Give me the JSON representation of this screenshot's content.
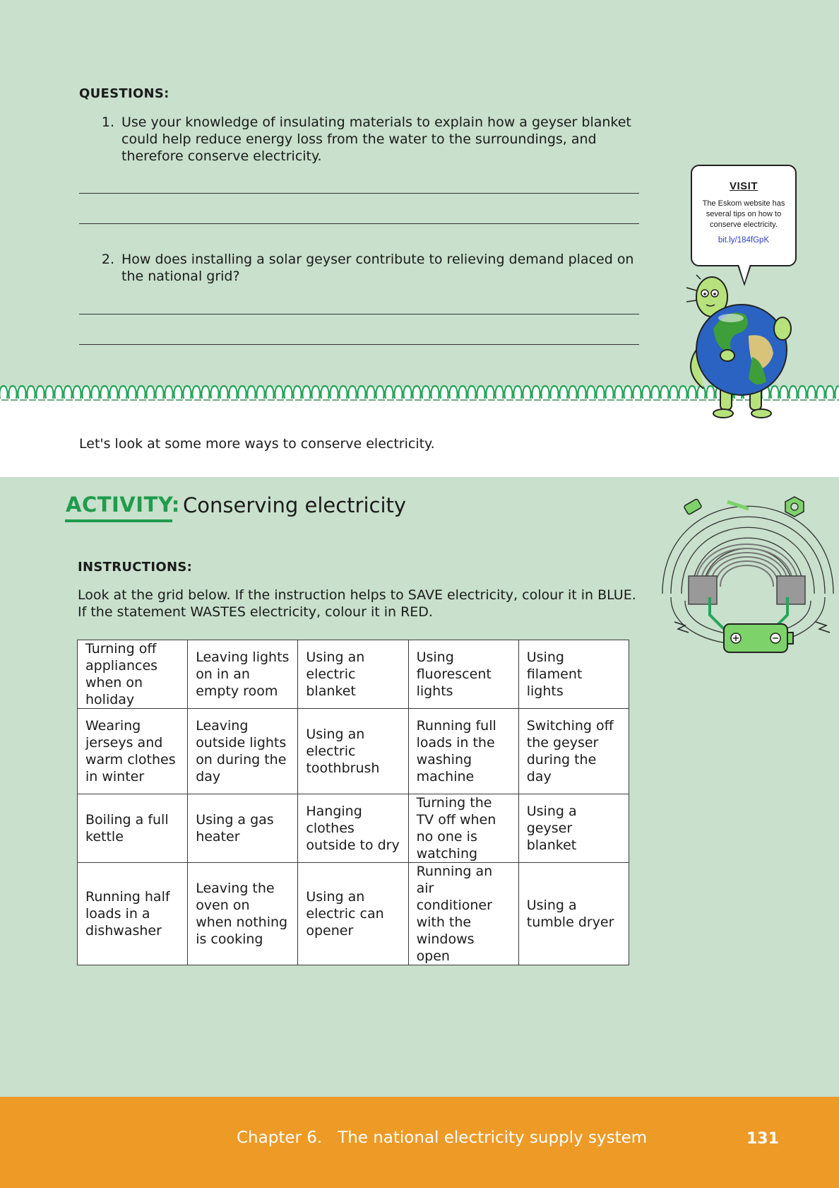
{
  "questions": {
    "heading": "QUESTIONS:",
    "items": [
      {
        "number": "1.",
        "text": "Use your knowledge of insulating materials to explain how a geyser blanket could help reduce energy loss from the water to the surroundings, and therefore conserve electricity."
      },
      {
        "number": "2.",
        "text": "How does installing a solar geyser contribute to relieving demand placed on the national grid?"
      }
    ]
  },
  "visit": {
    "title": "VISIT",
    "text": "The Eskom website has several tips on how to conserve electricity.",
    "link": "bit.ly/184fGpK"
  },
  "transition_text": "Let's look at some more ways to conserve electricity.",
  "activity": {
    "label": "ACTIVITY:",
    "title": "Conserving electricity",
    "instructions_heading": "INSTRUCTIONS:",
    "instructions_text": "Look at the grid below. If the instruction helps to SAVE electricity, colour it in BLUE. If the statement WASTES electricity, colour it in RED.",
    "grid": [
      [
        "Turning off appliances when on holiday",
        "Leaving lights on in an empty room",
        "Using an electric blanket",
        "Using fluorescent lights",
        "Using filament lights"
      ],
      [
        "Wearing jerseys and warm clothes in winter",
        "Leaving outside lights on during the day",
        "Using an electric toothbrush",
        "Running full loads in the washing machine",
        "Switching off the geyser during the day"
      ],
      [
        "Boiling a full kettle",
        "Using a gas heater",
        "Hanging clothes outside to dry",
        "Turning the TV off when no one is watching",
        "Using a geyser blanket"
      ],
      [
        "Running half loads in a dishwasher",
        "Leaving the oven on when nothing is cooking",
        "Using an electric can opener",
        "Running an air conditioner with the windows open",
        "Using a tumble dryer"
      ]
    ]
  },
  "footer": {
    "chapter": "Chapter 6.   The national electricity supply system",
    "page_number": "131"
  },
  "colors": {
    "page_background": "#c8e0cc",
    "activity_green": "#1f9c4c",
    "footer_orange": "#ed9a27",
    "link_blue": "#2c3ec2"
  },
  "icons": [
    "earth-character-illustration",
    "spring-coil-strip",
    "slinky-magnetic-field-illustration",
    "battery-icon"
  ]
}
